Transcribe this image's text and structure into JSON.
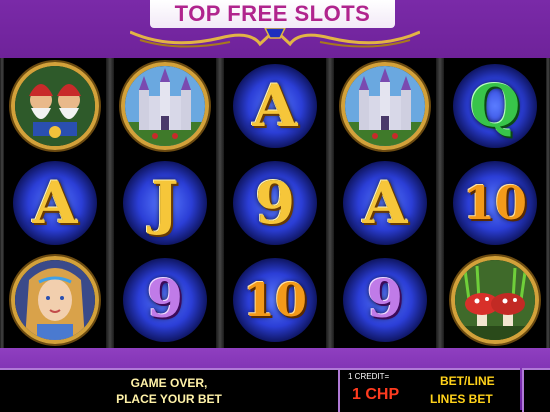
{
  "header": {
    "title": "TOP FREE SLOTS"
  },
  "reels": [
    [
      {
        "type": "symbol",
        "icon": "gnomes-icon"
      },
      {
        "type": "letter",
        "text": "A",
        "style": "gold"
      },
      {
        "type": "symbol",
        "icon": "princess-icon"
      }
    ],
    [
      {
        "type": "symbol",
        "icon": "castle-icon"
      },
      {
        "type": "letter",
        "text": "J",
        "style": "gold"
      },
      {
        "type": "letter",
        "text": "9",
        "style": "purple"
      }
    ],
    [
      {
        "type": "letter",
        "text": "A",
        "style": "gold"
      },
      {
        "type": "letter",
        "text": "9",
        "style": "gold"
      },
      {
        "type": "letter",
        "text": "10",
        "style": "orange"
      }
    ],
    [
      {
        "type": "symbol",
        "icon": "castle-icon"
      },
      {
        "type": "letter",
        "text": "A",
        "style": "gold"
      },
      {
        "type": "letter",
        "text": "9",
        "style": "purple"
      }
    ],
    [
      {
        "type": "letter",
        "text": "Q",
        "style": "green"
      },
      {
        "type": "letter",
        "text": "10",
        "style": "orange"
      },
      {
        "type": "symbol",
        "icon": "mushrooms-icon"
      }
    ]
  ],
  "status": {
    "message_line1": "GAME OVER,",
    "message_line2": "PLACE YOUR BET"
  },
  "credit": {
    "label": "1 CREDIT=",
    "value": "1 CHP"
  },
  "bet": {
    "bet_line_label": "BET/LINE",
    "lines_bet_label": "LINES BET"
  },
  "colors": {
    "frame": "#6a1fa0",
    "banner_text": "#b0248d",
    "status_text": "#fff2a8",
    "credit_value": "#ff3b1f",
    "bet_label": "#ffd21a"
  }
}
